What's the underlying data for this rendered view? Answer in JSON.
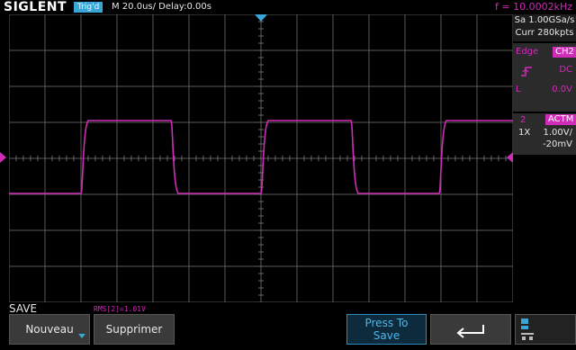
{
  "header": {
    "brand": "SIGLENT",
    "trigger_status": "Trig'd",
    "timebase": "M 20.0us/  Delay:0.00s",
    "frequency": "f = 10.0002kHz"
  },
  "acquisition": {
    "sample_rate": "Sa 1.00GSa/s",
    "memory": "Curr 280kpts"
  },
  "trigger": {
    "type_label": "Edge",
    "source": "CH2",
    "coupling": "DC",
    "level_label": "L",
    "level": "0.0V"
  },
  "channel": {
    "number": "2",
    "mode": "ACTM",
    "probe": "1X",
    "volts_per_div": "1.00V/",
    "offset": "-20mV"
  },
  "measurement": {
    "rms": "RMS[2]=1.01V"
  },
  "menu": {
    "title": "SAVE",
    "softkeys": [
      "Nouveau",
      "Supprimer",
      "",
      "Press To",
      "Save",
      ""
    ]
  },
  "colors": {
    "channel2": "#d02cb8",
    "accent": "#3aa6d6",
    "grid": "#5a5a5a"
  }
}
